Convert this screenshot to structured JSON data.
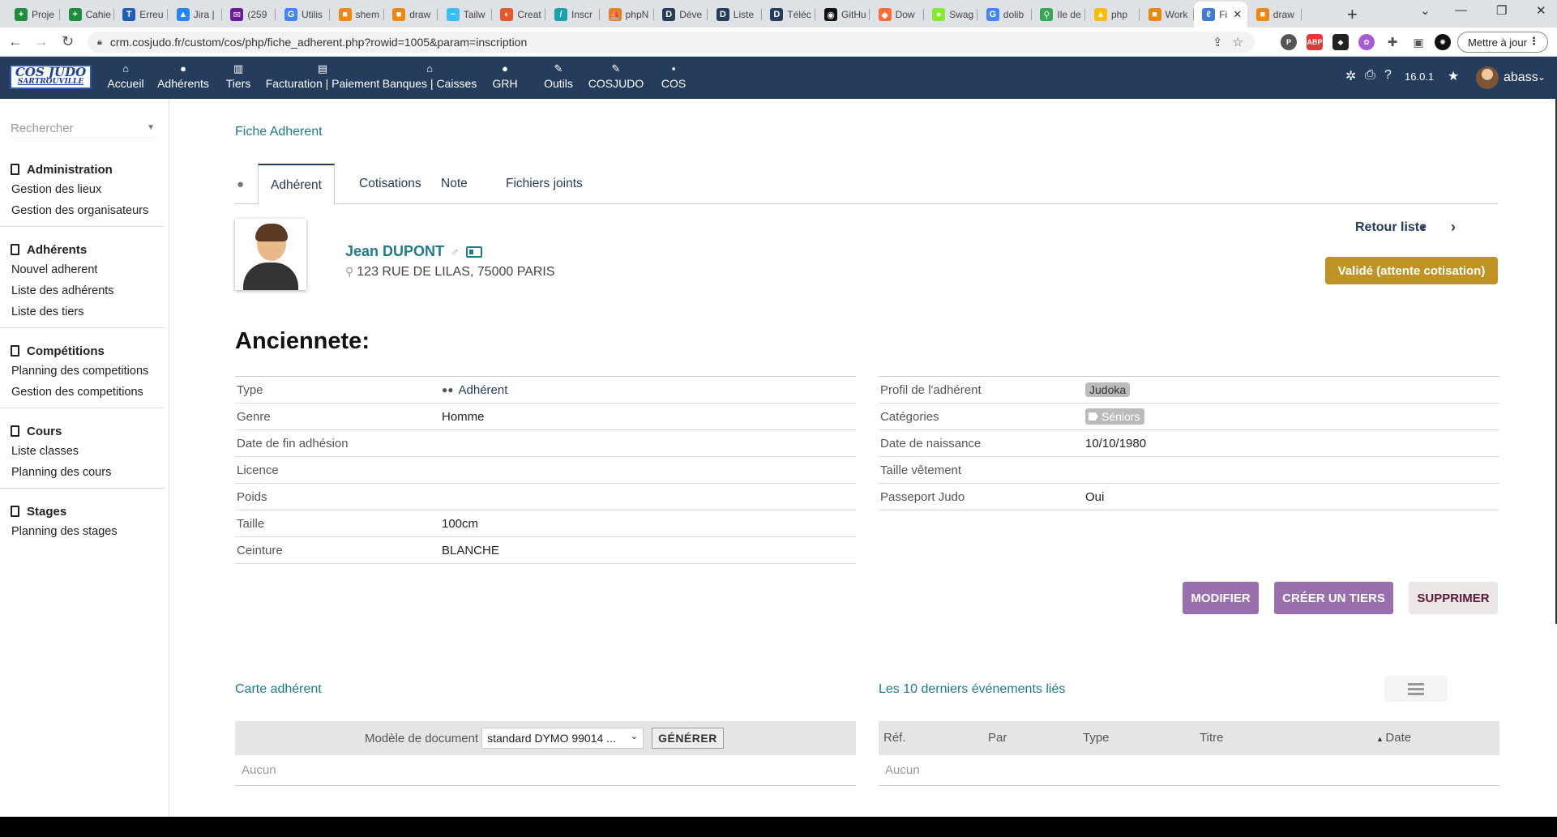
{
  "browser": {
    "tabs": [
      {
        "label": "Proje",
        "color": "#1e8e3e",
        "glyph": "+"
      },
      {
        "label": "Cahie",
        "color": "#1e8e3e",
        "glyph": "+"
      },
      {
        "label": "Erreu",
        "color": "#1f5fb8",
        "glyph": "T"
      },
      {
        "label": "Jira |",
        "color": "#2684ff",
        "glyph": "▲"
      },
      {
        "label": "(259",
        "color": "#6a1b9a",
        "glyph": "✉"
      },
      {
        "label": "Utilis",
        "color": "#4285f4",
        "glyph": "G"
      },
      {
        "label": "shem",
        "color": "#f08705",
        "glyph": "■"
      },
      {
        "label": "draw",
        "color": "#f08705",
        "glyph": "■"
      },
      {
        "label": "Tailw",
        "color": "#38bdf8",
        "glyph": "~"
      },
      {
        "label": "Creat",
        "color": "#e8562a",
        "glyph": "◐"
      },
      {
        "label": "Inscr",
        "color": "#1aa1b0",
        "glyph": "/"
      },
      {
        "label": "phpN",
        "color": "#e67e22",
        "glyph": "⛵"
      },
      {
        "label": "Déve",
        "color": "#263c5c",
        "glyph": "D"
      },
      {
        "label": "Liste",
        "color": "#263c5c",
        "glyph": "D"
      },
      {
        "label": "Téléc",
        "color": "#263c5c",
        "glyph": "D"
      },
      {
        "label": "GitHu",
        "color": "#111111",
        "glyph": "◉"
      },
      {
        "label": "Dow",
        "color": "#ff6c37",
        "glyph": "◆"
      },
      {
        "label": "Swag",
        "color": "#85ea2d",
        "glyph": "●"
      },
      {
        "label": "dolib",
        "color": "#4285f4",
        "glyph": "G"
      },
      {
        "label": "Ile de",
        "color": "#34a853",
        "glyph": "⚲"
      },
      {
        "label": "php",
        "color": "#fbbc04",
        "glyph": "▲"
      },
      {
        "label": "Work",
        "color": "#f08705",
        "glyph": "■"
      },
      {
        "label": "Fi",
        "color": "#3d7bd9",
        "glyph": "ℓ",
        "active": true
      },
      {
        "label": "draw",
        "color": "#f08705",
        "glyph": "■"
      }
    ],
    "url": "crm.cosjudo.fr/custom/cos/php/fiche_adherent.php?rowid=1005&param=inscription",
    "update_label": "Mettre à jour"
  },
  "app": {
    "logo_line1": "COS JUDO",
    "logo_line2": "SARTROUVILLE",
    "menu": [
      {
        "label": "Accueil",
        "icon": "home-icon",
        "glyph": "⌂"
      },
      {
        "label": "Adhérents",
        "icon": "user-icon",
        "glyph": "●"
      },
      {
        "label": "Tiers",
        "icon": "building-icon",
        "glyph": "▥"
      },
      {
        "label": "Facturation | Paiement",
        "icon": "money-icon",
        "glyph": "▤"
      },
      {
        "label": "Banques | Caisses",
        "icon": "bank-icon",
        "glyph": "⌂"
      },
      {
        "label": "GRH",
        "icon": "hr-icon",
        "glyph": "●"
      },
      {
        "label": "Outils",
        "icon": "wrench-icon",
        "glyph": "✎"
      },
      {
        "label": "COSJUDO",
        "icon": "edit-icon",
        "glyph": "✎"
      },
      {
        "label": "COS",
        "icon": "note-icon",
        "glyph": "▪"
      }
    ],
    "version": "16.0.1",
    "username": "abass"
  },
  "sidebar": {
    "search_placeholder": "Rechercher",
    "sections": [
      {
        "title": "Administration",
        "links": [
          "Gestion des lieux",
          "Gestion des organisateurs"
        ]
      },
      {
        "title": "Adhérents",
        "links": [
          "Nouvel adherent",
          "Liste des adhérents",
          "Liste des tiers"
        ]
      },
      {
        "title": "Compétitions",
        "links": [
          "Planning des competitions",
          "Gestion des competitions"
        ]
      },
      {
        "title": "Cours",
        "links": [
          "Liste classes",
          "Planning des cours"
        ]
      },
      {
        "title": "Stages",
        "links": [
          "Planning des stages"
        ]
      }
    ]
  },
  "page": {
    "breadcrumb": "Fiche Adherent",
    "tabs": [
      "Adhérent",
      "Cotisations",
      "Note",
      "Fichiers joints"
    ],
    "member_name": "Jean DUPONT",
    "gender_symbol": "♂",
    "address": "123 RUE DE LILAS, 75000 PARIS",
    "back_list": "Retour liste",
    "status": "Validé (attente cotisation)",
    "section_title": "Anciennete:",
    "left_fields": [
      {
        "label": "Type",
        "value": "Adhérent",
        "kind": "link"
      },
      {
        "label": "Genre",
        "value": "Homme"
      },
      {
        "label": "Date de fin adhésion",
        "value": ""
      },
      {
        "label": "Licence",
        "value": ""
      },
      {
        "label": "Poids",
        "value": ""
      },
      {
        "label": "Taille",
        "value": "100cm"
      },
      {
        "label": "Ceinture",
        "value": "BLANCHE"
      }
    ],
    "right_fields": [
      {
        "label": "Profil de l'adhérent",
        "value": "Judoka",
        "kind": "tag"
      },
      {
        "label": "Catégories",
        "value": "Séniors",
        "kind": "category"
      },
      {
        "label": "Date de naissance",
        "value": "10/10/1980"
      },
      {
        "label": "Taille vêtement",
        "value": ""
      },
      {
        "label": "Passeport Judo",
        "value": "Oui"
      }
    ],
    "actions": {
      "modify": "MODIFIER",
      "create_third_party": "CRÉER UN TIERS",
      "delete": "SUPPRIMER"
    },
    "card_section": {
      "title": "Carte adhérent",
      "model_label": "Modèle de document",
      "model_value": "standard DYMO 99014 ...",
      "generate_label": "GÉNÉRER",
      "empty": "Aucun"
    },
    "events_section": {
      "title": "Les 10 derniers événements liés",
      "columns": [
        "Réf.",
        "Par",
        "Type",
        "Titre",
        "Date"
      ],
      "empty": "Aucun"
    }
  },
  "colors": {
    "nav_bg": "#263c5c",
    "link": "#1f7a8c",
    "status_badge": "#bf9425",
    "action_purple": "#9a6fae"
  }
}
